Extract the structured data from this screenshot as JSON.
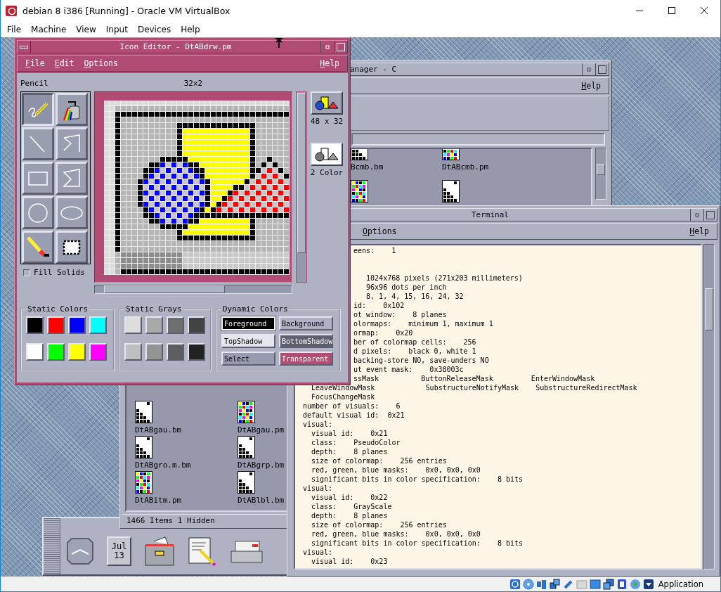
{
  "host": {
    "title": "debian 8 i386 [Running] - Oracle VM VirtualBox",
    "menu": [
      "File",
      "Machine",
      "View",
      "Input",
      "Devices",
      "Help"
    ],
    "status_text": "Application"
  },
  "file_manager": {
    "title": "anager - C",
    "help": "Help",
    "top_icons": [
      {
        "label": "Bcmb.bm",
        "kind": "bitmap"
      },
      {
        "label": "DtABcmb.pm",
        "kind": "pixmap"
      },
      {
        "kind": "pixmap"
      },
      {
        "kind": "bitmap"
      }
    ],
    "bottom_icons": [
      {
        "label": "DtABgau.bm",
        "kind": "bitmap"
      },
      {
        "label": "DtABgau.pm",
        "kind": "pixmap"
      },
      {
        "label": "DtABgro.m.bm",
        "kind": "bitmap"
      },
      {
        "label": "DtABgrp.bm",
        "kind": "bitmap"
      },
      {
        "label": "DtABitm.pm",
        "kind": "pixmap"
      },
      {
        "label": "DtABlbl.bm",
        "kind": "bitmap"
      }
    ],
    "status": "1466 Items 1 Hidden"
  },
  "terminal": {
    "title": "Terminal",
    "menu": [
      "Options"
    ],
    "help": "Help",
    "top_line": {
      "text": "eens:    1",
      "kind": "clipped"
    },
    "lines": [
      {
        "text": "   1024x768 pixels (271x203 millimeters)",
        "kind": "clipped"
      },
      {
        "text": "   96x96 dots per inch",
        "kind": "clipped"
      },
      {
        "text": "   8, 1, 4, 15, 16, 24, 32",
        "kind": "clipped"
      },
      {
        "text": "id:    0x102",
        "kind": "clipped"
      },
      {
        "text": "ot window:    8 planes",
        "kind": "clipped"
      },
      {
        "text": "olormaps:    minimum 1, maximum 1",
        "kind": "clipped"
      },
      {
        "text": "ormap:    0x20",
        "kind": "clipped"
      },
      {
        "text": "ber of colormap cells:    256",
        "kind": "clipped"
      },
      {
        "text": "d pixels:    black 0, white 1",
        "kind": "clipped"
      },
      {
        "text": "backing-store NO, save-unders NO",
        "kind": "clipped"
      },
      {
        "text": "ut event mask:    0x38003c",
        "kind": "clipped"
      },
      {
        "text": "ssMask          ButtonReleaseMask         EnterWindowMask",
        "kind": "clipped"
      },
      {
        "text": "  LeaveWindowMask            SubstructureNotifyMask    SubstructureRedirectMask",
        "kind": "full"
      },
      {
        "text": "  FocusChangeMask",
        "kind": "full"
      },
      {
        "text": "number of visuals:    6",
        "kind": "full"
      },
      {
        "text": "default visual id:  0x21",
        "kind": "full"
      },
      {
        "text": "visual:",
        "kind": "full"
      },
      {
        "text": "  visual id:    0x21",
        "kind": "full"
      },
      {
        "text": "  class:    PseudoColor",
        "kind": "full"
      },
      {
        "text": "  depth:    8 planes",
        "kind": "full"
      },
      {
        "text": "  size of colormap:    256 entries",
        "kind": "full"
      },
      {
        "text": "  red, green, blue masks:    0x0, 0x0, 0x0",
        "kind": "full"
      },
      {
        "text": "  significant bits in color specification:    8 bits",
        "kind": "full"
      },
      {
        "text": "visual:",
        "kind": "full"
      },
      {
        "text": "  visual id:    0x22",
        "kind": "full"
      },
      {
        "text": "  class:    GrayScale",
        "kind": "full"
      },
      {
        "text": "  depth:    8 planes",
        "kind": "full"
      },
      {
        "text": "  size of colormap:    256 entries",
        "kind": "full"
      },
      {
        "text": "  red, green, blue masks:    0x0, 0x0, 0x0",
        "kind": "full"
      },
      {
        "text": "  significant bits in color specification:    8 bits",
        "kind": "full"
      },
      {
        "text": "visual:",
        "kind": "full"
      },
      {
        "text": "  visual id:    0x23",
        "kind": "full"
      }
    ]
  },
  "icon_editor": {
    "title": "Icon Editor - DtABdrw.pm",
    "menu": [
      "File",
      "Edit",
      "Options"
    ],
    "help": "Help",
    "tool_label": "Pencil",
    "size_label": "32x2",
    "tools": [
      {
        "kind": "pencil",
        "selected": true
      },
      {
        "kind": "flood",
        "selected": false
      },
      {
        "kind": "line",
        "selected": false
      },
      {
        "kind": "polyline",
        "selected": false
      },
      {
        "kind": "rectangle",
        "selected": false
      },
      {
        "kind": "polygon",
        "selected": false
      },
      {
        "kind": "circle",
        "selected": false
      },
      {
        "kind": "ellipse",
        "selected": false
      },
      {
        "kind": "eraser",
        "selected": false
      },
      {
        "kind": "select",
        "selected": false
      }
    ],
    "fill_solids": {
      "label": "Fill Solids",
      "checked": false
    },
    "previews": [
      {
        "label": "48 x 32",
        "kind": "color"
      },
      {
        "label": "2 Color",
        "kind": "mono"
      }
    ],
    "static_colors": {
      "title": "Static Colors",
      "swatches": [
        {
          "color": "#000000"
        },
        {
          "color": "#ff0000"
        },
        {
          "color": "#0000ff"
        },
        {
          "color": "#00ffff"
        },
        {
          "color": "#ffffff"
        },
        {
          "color": "#00ff00"
        },
        {
          "color": "#ffff00"
        },
        {
          "color": "#ff00ff"
        }
      ]
    },
    "static_grays": {
      "title": "Static Grays",
      "swatches": [
        {
          "color": "#dcdcdc"
        },
        {
          "color": "#a9a9a9"
        },
        {
          "color": "#6e6e6e"
        },
        {
          "color": "#434343"
        },
        {
          "color": "#bebebe"
        },
        {
          "color": "#939393"
        },
        {
          "color": "#5e5e5e"
        },
        {
          "color": "#222222"
        }
      ]
    },
    "dynamic_colors": {
      "title": "Dynamic Colors",
      "buttons": [
        {
          "label": "Foreground",
          "color": "#000000",
          "selected": true
        },
        {
          "label": "Background",
          "color": "#aeb2c3",
          "selected": false
        },
        {
          "label": "TopShadow",
          "color": "#e4e6ee",
          "selected": false
        },
        {
          "label": "BottomShadow",
          "color": "#5c606e",
          "selected": false
        },
        {
          "label": "Select",
          "color": "#979bb0",
          "selected": false
        },
        {
          "label": "Transparent",
          "color": "#b24d72",
          "selected": false
        }
      ]
    }
  },
  "front_panel": {
    "month": "Jul",
    "day": "13"
  }
}
